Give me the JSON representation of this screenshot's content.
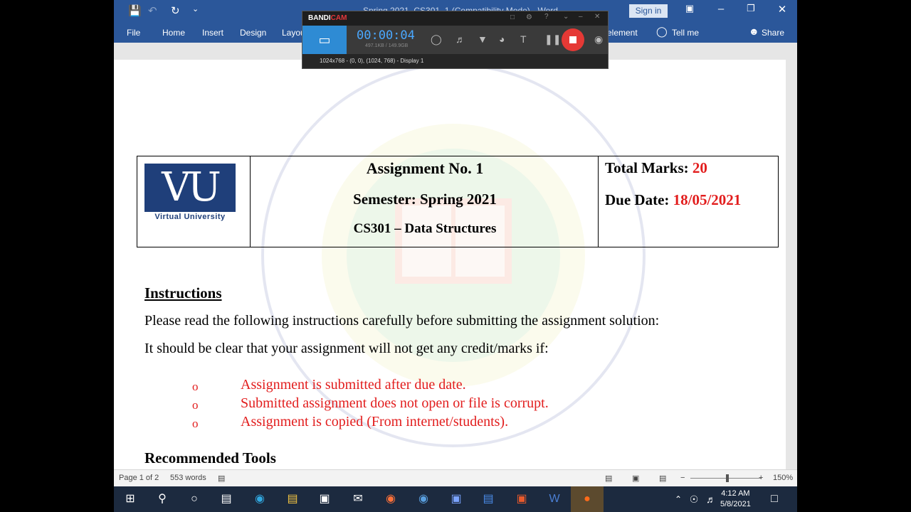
{
  "word": {
    "title_bar": {
      "doc_title": "Spring 2021_CS301_1 (Compatibility Mode) - Word",
      "sign_in": "Sign in"
    },
    "ribbon_tabs": [
      "File",
      "Home",
      "Insert",
      "Design",
      "Layou",
      "elemen t",
      "Tell me",
      "Share"
    ],
    "tabs": {
      "file": "File",
      "home": "Home",
      "insert": "Insert",
      "design": "Design",
      "layout": "Layou",
      "element": "element",
      "tell_me": "Tell me",
      "share": "Share"
    },
    "document": {
      "header": {
        "logo_text": "VU",
        "logo_sub": "Virtual University",
        "assignment": "Assignment No.  1",
        "semester": "Semester: Spring 2021",
        "course": "CS301 – Data Structures",
        "total_marks_label": "Total Marks: ",
        "total_marks_value": "20",
        "due_date_label": "Due Date:  ",
        "due_date_value": "18/05/2021"
      },
      "instructions_heading": "Instructions",
      "para1": "Please read the following instructions carefully before submitting the assignment solution:",
      "para2": "It should be clear that your assignment will not get any credit/marks if:",
      "bullets": [
        "Assignment is submitted after due date.",
        "Submitted assignment does not open or file is corrupt.",
        "Assignment is copied (From internet/students)."
      ],
      "bullet_symbol": "o",
      "next_heading": "Recommended Tools"
    },
    "status_bar": {
      "page": "Page 1 of 2",
      "words": "553 words",
      "zoom": "150%"
    }
  },
  "bandicam": {
    "brand_a": "BANDI",
    "brand_b": "CAM",
    "timer": "00:00:04",
    "size": "497.1KB / 149.9GB",
    "region": "1024x768 - (0, 0), (1024, 768) - Display 1"
  },
  "taskbar": {
    "time": "4:12 AM",
    "date": "5/8/2021"
  },
  "colors": {
    "word_blue": "#2b579a",
    "red_text": "#e21d1d",
    "vu_blue": "#1f3f7a"
  }
}
